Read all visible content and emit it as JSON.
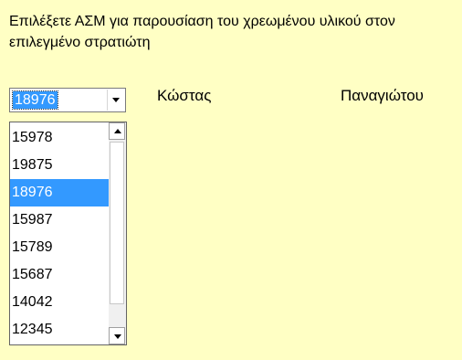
{
  "instructions": "Επιλέξετε ΑΣΜ για παρουσίαση του χρεωμένου υλικού στον επιλεγμένο στρατιώτη",
  "combo": {
    "selected_value": "18976"
  },
  "soldier": {
    "first_name": "Κώστας",
    "last_name": "Παναγιώτου"
  },
  "dropdown": {
    "options": [
      "15978",
      "19875",
      "18976",
      "15987",
      "15789",
      "15687",
      "14042",
      "12345"
    ],
    "selected_index": 2
  },
  "colors": {
    "background": "#ffffc4",
    "selection": "#3399ff"
  }
}
